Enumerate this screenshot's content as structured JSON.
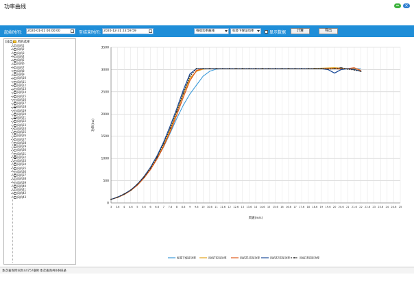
{
  "window": {
    "title": "功率曲线",
    "close_glyph": "×"
  },
  "toolbar": {
    "start_label": "起始时间:",
    "start_value": "2020-01-01 00:00:00",
    "end_label": "至结束时间:",
    "end_value": "2020-12-31 23:59:59",
    "curve_select": "每提功率曲线",
    "baseline_select": "标签下保证功率",
    "show_data_label": "显示数据",
    "show_data_checked": false,
    "calc_button": "计算",
    "export_button": "导出"
  },
  "tree": {
    "root_label": "风机选择",
    "items": [
      {
        "label": "风机1",
        "checked": false
      },
      {
        "label": "风机2",
        "checked": false
      },
      {
        "label": "风机3",
        "checked": false
      },
      {
        "label": "风机4",
        "checked": false
      },
      {
        "label": "风机5",
        "checked": false
      },
      {
        "label": "风机6",
        "checked": false
      },
      {
        "label": "风机7",
        "checked": false
      },
      {
        "label": "风机8",
        "checked": false
      },
      {
        "label": "风机9",
        "checked": false
      },
      {
        "label": "风机10",
        "checked": false
      },
      {
        "label": "风机11",
        "checked": false
      },
      {
        "label": "风机12",
        "checked": false
      },
      {
        "label": "风机13",
        "checked": false
      },
      {
        "label": "风机14",
        "checked": false
      },
      {
        "label": "风机15",
        "checked": false
      },
      {
        "label": "风机16",
        "checked": false
      },
      {
        "label": "风机17",
        "checked": false
      },
      {
        "label": "风机18",
        "checked": true
      },
      {
        "label": "风机19",
        "checked": false
      },
      {
        "label": "风机20",
        "checked": false
      },
      {
        "label": "风机21",
        "checked": true
      },
      {
        "label": "风机22",
        "checked": false
      },
      {
        "label": "风机23",
        "checked": false
      },
      {
        "label": "风机24",
        "checked": false
      },
      {
        "label": "风机25",
        "checked": false
      },
      {
        "label": "风机26",
        "checked": false
      },
      {
        "label": "风机27",
        "checked": false
      },
      {
        "label": "风机28",
        "checked": false
      },
      {
        "label": "风机29",
        "checked": false
      },
      {
        "label": "风机30",
        "checked": false
      },
      {
        "label": "风机31",
        "checked": false
      },
      {
        "label": "风机32",
        "checked": true
      },
      {
        "label": "风机33",
        "checked": false
      },
      {
        "label": "风机34",
        "checked": false
      },
      {
        "label": "风机35",
        "checked": false
      },
      {
        "label": "风机36",
        "checked": false
      },
      {
        "label": "风机37",
        "checked": false
      },
      {
        "label": "风机38",
        "checked": false
      },
      {
        "label": "风机39",
        "checked": false
      },
      {
        "label": "风机40",
        "checked": false
      },
      {
        "label": "风机41",
        "checked": false
      },
      {
        "label": "风机42",
        "checked": false
      },
      {
        "label": "风机43",
        "checked": false
      }
    ]
  },
  "status": {
    "left": "本次查询时间为4475?毫秒",
    "right": "本次查询共0条纪录"
  },
  "chart_data": {
    "type": "line",
    "title": "",
    "xlabel": "风速(m/s)",
    "ylabel": "功率(kw)",
    "xlim": [
      3,
      25
    ],
    "ylim": [
      0,
      3500
    ],
    "grid": true,
    "legend_position": "bottom",
    "x_ticks": [
      "3",
      "3.6",
      "4",
      "4.6",
      "5",
      "5.6",
      "6",
      "6.6",
      "7",
      "7.6",
      "8",
      "8.6",
      "9",
      "9.6",
      "10",
      "10.6",
      "11",
      "11.6",
      "12",
      "12.6",
      "13",
      "13.6",
      "14",
      "14.6",
      "15",
      "15.6",
      "16",
      "16.6",
      "17",
      "17.6",
      "18",
      "18.6",
      "19",
      "19.6",
      "20",
      "20.6",
      "21",
      "21.6",
      "22",
      "22.6",
      "23",
      "23.6",
      "24",
      "24.6",
      "25"
    ],
    "x_tick_values": [
      3,
      3.5,
      4,
      4.5,
      5,
      5.5,
      6,
      6.5,
      7,
      7.5,
      8,
      8.5,
      9,
      9.5,
      10,
      10.5,
      11,
      11.5,
      12,
      12.5,
      13,
      13.5,
      14,
      14.5,
      15,
      15.5,
      16,
      16.5,
      17,
      17.5,
      18,
      18.5,
      19,
      19.5,
      20,
      20.5,
      21,
      21.5,
      22,
      22.5,
      23,
      23.5,
      24,
      24.5,
      25
    ],
    "y_ticks": [
      0,
      500,
      1000,
      1500,
      2000,
      2500,
      3000,
      3500
    ],
    "series": [
      {
        "name": "标签下保证功率",
        "color": "#3b9ad9",
        "dashed": false,
        "markers": false,
        "x": [
          3,
          3.5,
          4,
          4.5,
          5,
          5.5,
          6,
          6.5,
          7,
          7.5,
          8,
          8.5,
          9,
          9.5,
          10,
          10.5,
          11,
          11.5,
          12,
          13,
          14,
          15,
          16,
          17,
          18,
          19,
          20,
          21,
          22
        ],
        "y": [
          80,
          130,
          200,
          290,
          420,
          580,
          760,
          990,
          1260,
          1570,
          1900,
          2200,
          2450,
          2650,
          2850,
          2960,
          3010,
          3020,
          3020,
          3020,
          3020,
          3020,
          3020,
          3020,
          3020,
          3020,
          3020,
          3020,
          3020
        ]
      },
      {
        "name": "风机7实际功率",
        "color": "#e3a21a",
        "dashed": false,
        "markers": false,
        "x": [
          3,
          3.5,
          4,
          4.5,
          5,
          5.5,
          6,
          6.5,
          7,
          7.5,
          8,
          8.5,
          9,
          9.5,
          10,
          10.5,
          11,
          12,
          13,
          14,
          15,
          16,
          17,
          18,
          19,
          20,
          20.5,
          21,
          21.5,
          22
        ],
        "y": [
          80,
          125,
          190,
          280,
          400,
          560,
          760,
          1010,
          1300,
          1650,
          2050,
          2450,
          2800,
          2960,
          3010,
          3020,
          3020,
          3020,
          3020,
          3020,
          3020,
          3020,
          3020,
          3020,
          3030,
          3040,
          3030,
          3020,
          3010,
          2960
        ]
      },
      {
        "name": "风机21实际功率",
        "color": "#e05a1c",
        "dashed": false,
        "markers": false,
        "x": [
          3,
          3.5,
          4,
          4.5,
          5,
          5.5,
          6,
          6.5,
          7,
          7.5,
          8,
          8.5,
          9,
          9.5,
          10,
          10.5,
          11,
          12,
          13,
          14,
          15,
          16,
          17,
          18,
          19,
          20,
          20.5,
          21,
          21.5,
          22
        ],
        "y": [
          80,
          125,
          190,
          280,
          400,
          560,
          750,
          990,
          1270,
          1600,
          1980,
          2380,
          2750,
          2980,
          3020,
          3020,
          3020,
          3020,
          3020,
          3020,
          3020,
          3020,
          3020,
          3020,
          3020,
          3020,
          3010,
          3020,
          3040,
          2980
        ]
      },
      {
        "name": "风机32实际功率",
        "color": "#1f4e9a",
        "dashed": false,
        "markers": false,
        "x": [
          3,
          3.5,
          4,
          4.5,
          5,
          5.5,
          6,
          6.5,
          7,
          7.5,
          8,
          8.5,
          9,
          9.5,
          10,
          10.5,
          11,
          12,
          13,
          14,
          15,
          16,
          17,
          18,
          19,
          19.5,
          20,
          20.5,
          21,
          21.5,
          22
        ],
        "y": [
          80,
          130,
          200,
          290,
          420,
          590,
          800,
          1060,
          1370,
          1730,
          2120,
          2540,
          2900,
          3020,
          3020,
          3020,
          3020,
          3020,
          3020,
          3020,
          3020,
          3020,
          3020,
          3020,
          3020,
          3000,
          2920,
          3000,
          3020,
          3000,
          2960
        ]
      },
      {
        "name": "风机18实际功率",
        "color": "#333333",
        "dashed": true,
        "markers": true,
        "x": [
          3,
          3.5,
          4,
          4.5,
          5,
          5.5,
          6,
          6.5,
          7,
          7.5,
          8,
          8.5,
          9,
          9.5,
          10,
          10.5,
          11,
          11.5,
          12,
          12.5,
          13,
          13.5,
          14,
          14.5,
          15,
          15.5,
          16,
          16.5,
          17,
          17.5,
          18,
          18.5,
          19,
          19.5,
          20,
          20.5,
          21,
          21.5,
          22
        ],
        "y": [
          80,
          130,
          200,
          290,
          420,
          580,
          780,
          1030,
          1330,
          1680,
          2060,
          2470,
          2850,
          3020,
          3020,
          3020,
          3020,
          3020,
          3020,
          3020,
          3020,
          3020,
          3020,
          3020,
          3020,
          3020,
          3020,
          3020,
          3020,
          3020,
          3020,
          3020,
          3020,
          3010,
          3020,
          3040,
          3010,
          2990,
          2960
        ]
      }
    ]
  }
}
